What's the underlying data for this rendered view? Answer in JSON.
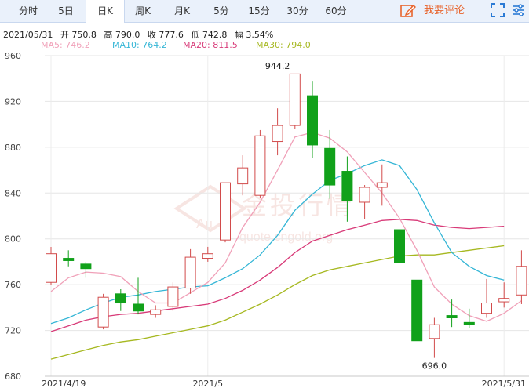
{
  "tabs": [
    {
      "label": "分时"
    },
    {
      "label": "5日"
    },
    {
      "label": "日K",
      "active": true
    },
    {
      "label": "周K"
    },
    {
      "label": "月K"
    },
    {
      "label": "5分"
    },
    {
      "label": "15分"
    },
    {
      "label": "30分"
    },
    {
      "label": "60分"
    }
  ],
  "comment_label": "我要评论",
  "info": {
    "date": "2021/05/31",
    "open": "开 750.8",
    "high": "高 790.0",
    "close": "收 777.6",
    "low": "低 742.8",
    "amp": "幅 3.54%"
  },
  "ma_labels": [
    {
      "text": "MA5: 746.2",
      "color": "#f0a0b8"
    },
    {
      "text": "MA10: 764.2",
      "color": "#35b6d6"
    },
    {
      "text": "MA20: 811.5",
      "color": "#d83a78"
    },
    {
      "text": "MA30: 794.0",
      "color": "#a6b820"
    }
  ],
  "colors": {
    "up": "#d24b4b",
    "down": "#11a11a",
    "ma5": "#f0a0b8",
    "ma10": "#35b6d6",
    "ma20": "#d83a78",
    "ma30": "#a6b820"
  },
  "chart_data": {
    "type": "candlestick",
    "ylim": [
      680,
      960
    ],
    "y_ticks": [
      960,
      920,
      880,
      840,
      800,
      760,
      720,
      680
    ],
    "x_labels": [
      {
        "text": "2021/4/19",
        "index": 0
      },
      {
        "text": "2021/5",
        "index": 9
      },
      {
        "text": "2021/5/31",
        "index": 26
      }
    ],
    "annotations": [
      {
        "text": "944.2",
        "index": 13,
        "value": 944.2
      },
      {
        "text": "696.0",
        "index": 22,
        "value": 696.0
      }
    ],
    "candles": [
      {
        "o": 762,
        "c": 787,
        "h": 793,
        "l": 760
      },
      {
        "o": 783,
        "c": 781,
        "h": 790,
        "l": 776
      },
      {
        "o": 778,
        "c": 774,
        "h": 780,
        "l": 766
      },
      {
        "o": 723,
        "c": 749,
        "h": 752,
        "l": 721
      },
      {
        "o": 752,
        "c": 744,
        "h": 756,
        "l": 737
      },
      {
        "o": 743,
        "c": 737,
        "h": 766,
        "l": 734
      },
      {
        "o": 734,
        "c": 738,
        "h": 742,
        "l": 731
      },
      {
        "o": 741,
        "c": 758,
        "h": 762,
        "l": 737
      },
      {
        "o": 757,
        "c": 784,
        "h": 791,
        "l": 752
      },
      {
        "o": 783,
        "c": 787,
        "h": 793,
        "l": 780
      },
      {
        "o": 799,
        "c": 849,
        "h": 849,
        "l": 797
      },
      {
        "o": 848,
        "c": 862,
        "h": 873,
        "l": 838
      },
      {
        "o": 838,
        "c": 890,
        "h": 895,
        "l": 836
      },
      {
        "o": 885,
        "c": 899,
        "h": 914,
        "l": 873
      },
      {
        "o": 899,
        "c": 944,
        "h": 944,
        "l": 896
      },
      {
        "o": 925,
        "c": 882,
        "h": 938,
        "l": 871
      },
      {
        "o": 879,
        "c": 847,
        "h": 895,
        "l": 835
      },
      {
        "o": 859,
        "c": 833,
        "h": 872,
        "l": 815
      },
      {
        "o": 832,
        "c": 845,
        "h": 847,
        "l": 817
      },
      {
        "o": 845,
        "c": 849,
        "h": 865,
        "l": 829
      },
      {
        "o": 808,
        "c": 779,
        "h": 808,
        "l": 779
      },
      {
        "o": 764,
        "c": 711,
        "h": 764,
        "l": 711
      },
      {
        "o": 713,
        "c": 725,
        "h": 731,
        "l": 696
      },
      {
        "o": 733,
        "c": 731,
        "h": 747,
        "l": 723
      },
      {
        "o": 727,
        "c": 725,
        "h": 739,
        "l": 722
      },
      {
        "o": 735,
        "c": 744,
        "h": 765,
        "l": 731
      },
      {
        "o": 745,
        "c": 748,
        "h": 762,
        "l": 740
      },
      {
        "o": 751,
        "c": 776,
        "h": 790,
        "l": 743
      }
    ],
    "ma5": [
      754,
      766,
      771,
      770,
      767,
      754,
      744,
      744,
      753,
      762,
      779,
      810,
      832,
      860,
      889,
      893,
      888,
      876,
      858,
      840,
      818,
      790,
      758,
      743,
      733,
      728,
      735,
      746
    ],
    "ma10": [
      726,
      731,
      738,
      744,
      749,
      751,
      754,
      756,
      758,
      759,
      766,
      774,
      786,
      803,
      825,
      839,
      851,
      857,
      864,
      869,
      864,
      843,
      814,
      788,
      776,
      768,
      764
    ],
    "ma20": [
      719,
      724,
      729,
      732,
      734,
      735,
      737,
      739,
      741,
      743,
      748,
      755,
      764,
      775,
      788,
      798,
      803,
      808,
      812,
      816,
      817,
      816,
      812,
      810,
      809,
      810,
      811
    ],
    "ma30": [
      695,
      699,
      703,
      707,
      710,
      712,
      715,
      718,
      721,
      724,
      729,
      736,
      743,
      751,
      760,
      768,
      773,
      776,
      779,
      782,
      785,
      786,
      786,
      788,
      790,
      792,
      794
    ]
  }
}
